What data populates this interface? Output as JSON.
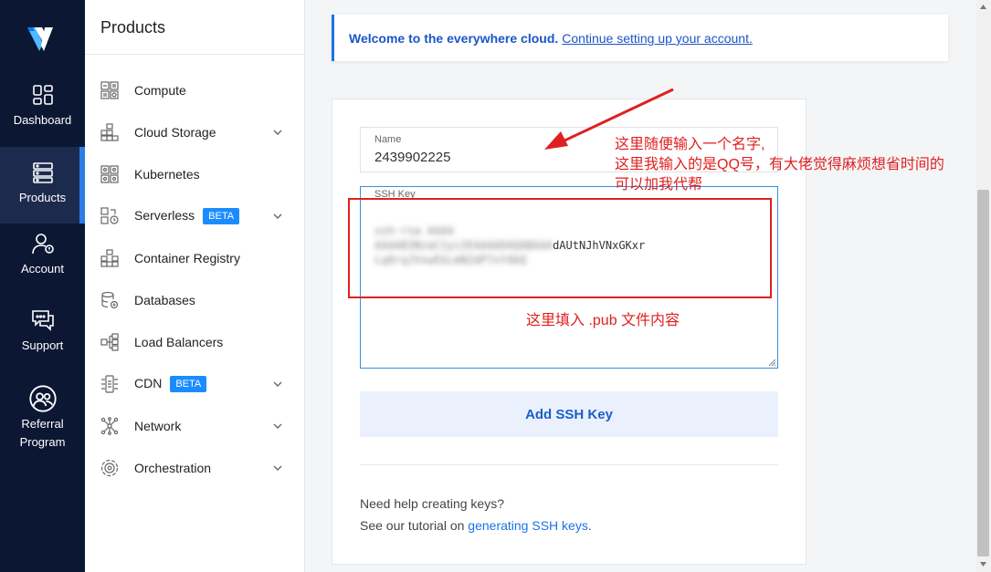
{
  "rail": {
    "items": [
      {
        "label": "Dashboard",
        "icon": "dashboard-icon"
      },
      {
        "label": "Products",
        "icon": "products-icon"
      },
      {
        "label": "Account",
        "icon": "account-icon"
      },
      {
        "label": "Support",
        "icon": "support-icon"
      },
      {
        "label_line1": "Referral",
        "label_line2": "Program",
        "icon": "referral-icon"
      }
    ]
  },
  "sidebar": {
    "title": "Products",
    "items": [
      {
        "label": "Compute",
        "icon": "compute-icon"
      },
      {
        "label": "Cloud Storage",
        "icon": "cloud-storage-icon"
      },
      {
        "label": "Kubernetes",
        "icon": "kubernetes-icon"
      },
      {
        "label": "Serverless",
        "badge": "BETA",
        "icon": "serverless-icon"
      },
      {
        "label": "Container Registry",
        "icon": "container-registry-icon"
      },
      {
        "label": "Databases",
        "icon": "databases-icon"
      },
      {
        "label": "Load Balancers",
        "icon": "load-balancers-icon"
      },
      {
        "label": "CDN",
        "badge": "BETA",
        "icon": "cdn-icon"
      },
      {
        "label": "Network",
        "icon": "network-icon"
      },
      {
        "label": "Orchestration",
        "icon": "orchestration-icon"
      }
    ]
  },
  "banner": {
    "bold": "Welcome to the everywhere cloud.",
    "link": "Continue setting up your account."
  },
  "form": {
    "name_label": "Name",
    "name_value": "2439902225",
    "ssh_label": "SSH Key",
    "ssh_visible_fragment": "dAUtNJhVNxGKxr",
    "submit_label": "Add SSH Key"
  },
  "help": {
    "line1": "Need help creating keys?",
    "line2_prefix": "See our tutorial on",
    "link": "generating SSH keys",
    "line2_suffix": "."
  },
  "annotations": {
    "name_note": [
      "这里随便输入一个名字,",
      "这里我输入的是QQ号，有大佬觉得麻烦想省时间的",
      "可以加我代帮"
    ],
    "key_note": "这里填入 .pub 文件内容"
  },
  "colors": {
    "rail_bg": "#0b1733",
    "accent": "#1a73e8",
    "annotation": "#e02020",
    "beta_badge": "#1a8cff"
  }
}
